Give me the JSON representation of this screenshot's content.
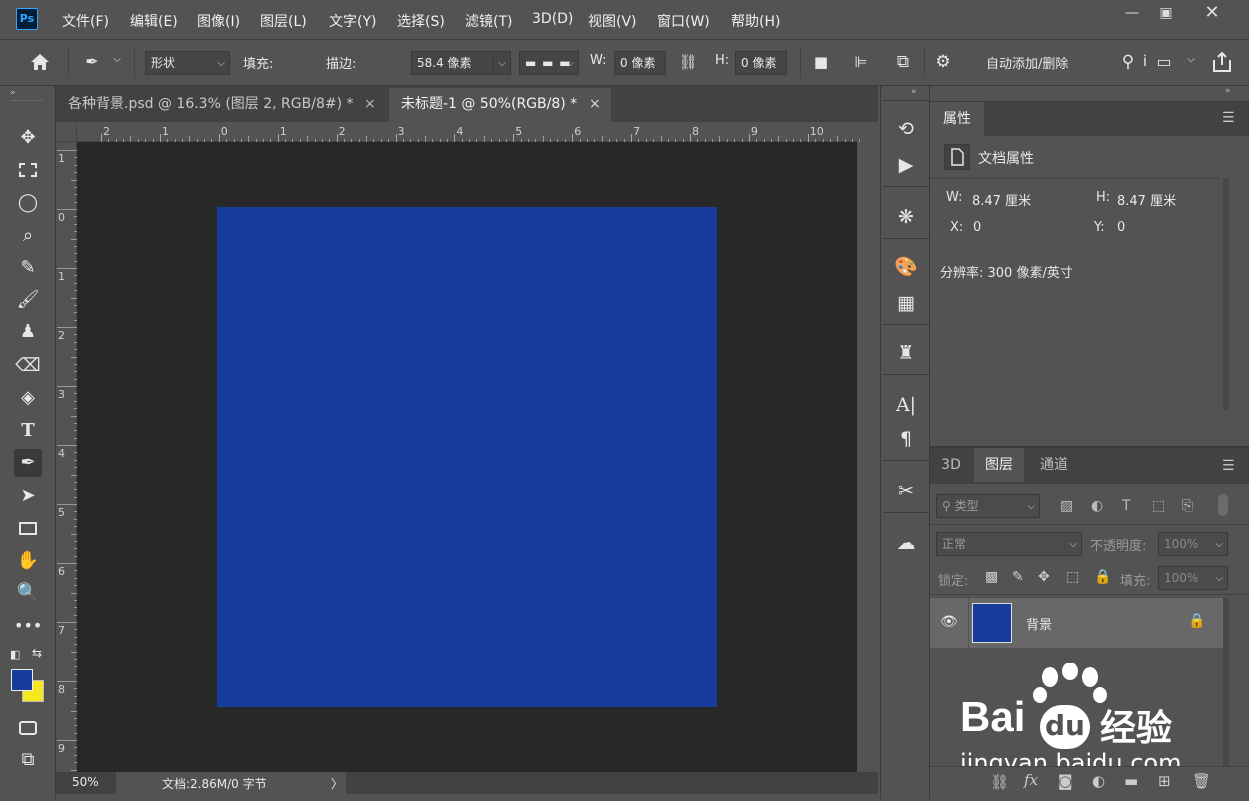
{
  "app": {
    "logo": "Ps"
  },
  "menu": [
    "文件(F)",
    "编辑(E)",
    "图像(I)",
    "图层(L)",
    "文字(Y)",
    "选择(S)",
    "滤镜(T)",
    "3D(D)",
    "视图(V)",
    "窗口(W)",
    "帮助(H)"
  ],
  "options": {
    "mode": "形状",
    "fill_label": "填充:",
    "fill_color": "#1a3fa6",
    "stroke_label": "描边:",
    "stroke_width": "58.4 像素",
    "w_label": "W:",
    "w_value": "0 像素",
    "h_label": "H:",
    "h_value": "0 像素",
    "auto_add_delete": "自动添加/删除"
  },
  "tabs": [
    {
      "label": "各种背景.psd @ 16.3% (图层 2, RGB/8#) *",
      "close": "×"
    },
    {
      "label": "未标题-1 @ 50%(RGB/8) *",
      "close": "×"
    }
  ],
  "ruler_top": [
    "2",
    "1",
    "0",
    "1",
    "2",
    "3",
    "4",
    "5",
    "6",
    "7",
    "8",
    "9",
    "10"
  ],
  "ruler_left": [
    "1",
    "0",
    "1",
    "2",
    "3",
    "4",
    "5",
    "6",
    "7",
    "8",
    "9"
  ],
  "canvas": {
    "fill_color": "#163d9e",
    "background": "#282828"
  },
  "status": {
    "zoom": "50%",
    "doc_info": "文档:2.86M/0 字节",
    "arrow": "〉"
  },
  "properties": {
    "tab": "属性",
    "doc_props": "文档属性",
    "w_label": "W:",
    "w_value": "8.47 厘米",
    "h_label": "H:",
    "h_value": "8.47 厘米",
    "x_label": "X:",
    "x_value": "0",
    "y_label": "Y:",
    "y_value": "0",
    "resolution": "分辨率: 300 像素/英寸"
  },
  "layers": {
    "tabs": [
      "3D",
      "图层",
      "通道"
    ],
    "filter_label": "类型",
    "blend_mode": "正常",
    "opacity_label": "不透明度:",
    "opacity_value": "100%",
    "lock_label": "锁定:",
    "fill_label": "填充:",
    "fill_value": "100%",
    "items": [
      {
        "name": "背景",
        "thumb_color": "#163d9e"
      }
    ]
  },
  "watermark": {
    "brand": "Bai",
    "brand2": "du",
    "brand_cn": "经验",
    "url": "jingyan.baidu.com"
  }
}
